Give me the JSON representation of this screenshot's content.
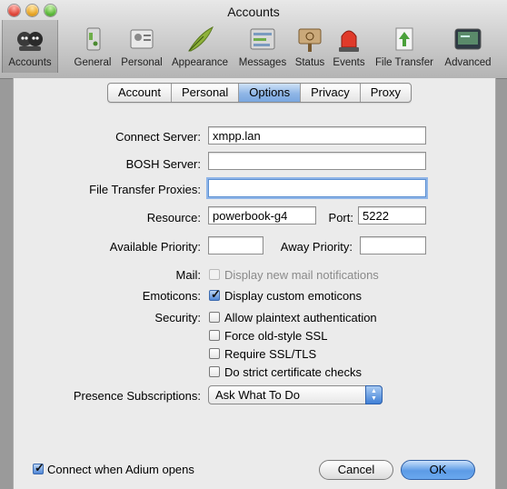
{
  "window": {
    "title": "Accounts"
  },
  "toolbar": {
    "items": [
      {
        "label": "Accounts",
        "icon": "accounts-icon",
        "selected": true
      },
      {
        "label": "General",
        "icon": "general-icon"
      },
      {
        "label": "Personal",
        "icon": "personal-icon"
      },
      {
        "label": "Appearance",
        "icon": "appearance-icon"
      },
      {
        "label": "Messages",
        "icon": "messages-icon"
      },
      {
        "label": "Status",
        "icon": "status-icon"
      },
      {
        "label": "Events",
        "icon": "events-icon"
      },
      {
        "label": "File Transfer",
        "icon": "file-transfer-icon"
      },
      {
        "label": "Advanced",
        "icon": "advanced-icon"
      }
    ]
  },
  "tabs": [
    "Account",
    "Personal",
    "Options",
    "Privacy",
    "Proxy"
  ],
  "active_tab": "Options",
  "form": {
    "connect_server": {
      "label": "Connect Server:",
      "value": "xmpp.lan"
    },
    "bosh_server": {
      "label": "BOSH Server:",
      "value": ""
    },
    "file_transfer_proxies": {
      "label": "File Transfer Proxies:",
      "value": ""
    },
    "resource": {
      "label": "Resource:",
      "value": "powerbook-g4"
    },
    "port": {
      "label": "Port:",
      "value": "5222"
    },
    "available_priority": {
      "label": "Available Priority:",
      "value": ""
    },
    "away_priority": {
      "label": "Away Priority:",
      "value": ""
    },
    "mail": {
      "label": "Mail:",
      "option": "Display new mail notifications",
      "checked": false,
      "enabled": false
    },
    "emoticons": {
      "label": "Emoticons:",
      "option": "Display custom emoticons",
      "checked": true
    },
    "security": {
      "label": "Security:",
      "options": [
        {
          "text": "Allow plaintext authentication",
          "checked": false
        },
        {
          "text": "Force old-style SSL",
          "checked": false
        },
        {
          "text": "Require SSL/TLS",
          "checked": false
        },
        {
          "text": "Do strict certificate checks",
          "checked": false
        }
      ]
    },
    "presence_subscriptions": {
      "label": "Presence Subscriptions:",
      "value": "Ask What To Do"
    }
  },
  "footer": {
    "connect_on_open": {
      "text": "Connect when Adium opens",
      "checked": true
    },
    "cancel_label": "Cancel",
    "ok_label": "OK"
  },
  "colors": {
    "accent": "#5c9be6",
    "selected_tab": "#8fb6e6"
  }
}
